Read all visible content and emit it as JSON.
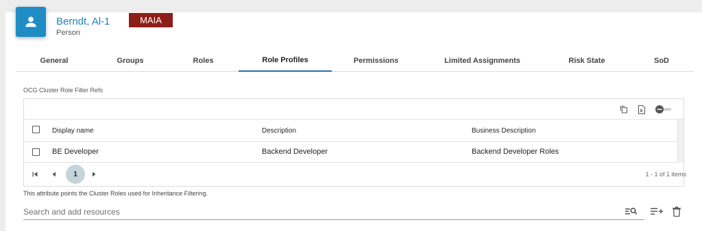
{
  "header": {
    "name": "Berndt, Al-1",
    "type": "Person",
    "badge": "MAIA"
  },
  "tabs": [
    {
      "label": "General"
    },
    {
      "label": "Groups"
    },
    {
      "label": "Roles"
    },
    {
      "label": "Role Profiles",
      "active": true
    },
    {
      "label": "Permissions"
    },
    {
      "label": "Limited Assignments"
    },
    {
      "label": "Risk State"
    },
    {
      "label": "SoD"
    }
  ],
  "section": {
    "label": "OCG Cluster Role Filter Refs"
  },
  "grid": {
    "columns": [
      "Display name",
      "Description",
      "Business Description"
    ],
    "rows": [
      {
        "display_name": "BE Developer",
        "description": "Backend Developer",
        "business_description": "Backend Developer Roles"
      }
    ],
    "toolbar_icons": [
      "copy-icon",
      "excel-export-icon",
      "toggle-switch"
    ],
    "pager": {
      "current_page": "1",
      "info": "1 - 1 of 1 items"
    }
  },
  "hint": "This attribute points the Cluster Roles used for Inheritance Filtering.",
  "search": {
    "placeholder": "Search and add resources",
    "value": ""
  },
  "actions": [
    "search-list-icon",
    "add-list-icon",
    "delete-icon"
  ],
  "colors": {
    "accent": "#1f8dc4",
    "badge": "#8d1d17",
    "active_tab_underline": "#2a6bb0"
  }
}
